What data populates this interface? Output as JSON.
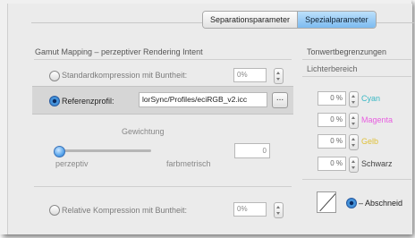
{
  "tabs": {
    "separation": "Separationsparameter",
    "special": "Spezialparameter"
  },
  "gamut": {
    "title": "Gamut Mapping – perzeptiver Rendering Intent",
    "standard_label": "Standardkompression mit Buntheit:",
    "standard_value": "0%",
    "reference_label": "Referenzprofil:",
    "reference_value": "lorSync/Profiles/eciRGB_v2.icc",
    "browse_label": "...",
    "weighting_label": "Gewichtung",
    "perceptual_label": "perzeptiv",
    "colorimetric_label": "farbmetrisch",
    "weighting_value": "0",
    "relative_label": "Relative Kompression mit Buntheit:",
    "relative_value": "0%"
  },
  "tonal": {
    "title": "Tonwertbegrenzungen",
    "highlight_title": "Lichterbereich",
    "rows": [
      {
        "value": "0 %",
        "label": "Cyan"
      },
      {
        "value": "0 %",
        "label": "Magenta"
      },
      {
        "value": "0 %",
        "label": "Gelb"
      },
      {
        "value": "0 %",
        "label": "Schwarz"
      }
    ],
    "cutoff_label": "– Abschneid"
  },
  "colors": {
    "cyan": "#39b8c4",
    "magenta": "#e85ee0",
    "gelb": "#e0c13a",
    "schwarz": "#444444",
    "accent": "#4b9be0"
  },
  "slider": {
    "position_percent": 0
  }
}
